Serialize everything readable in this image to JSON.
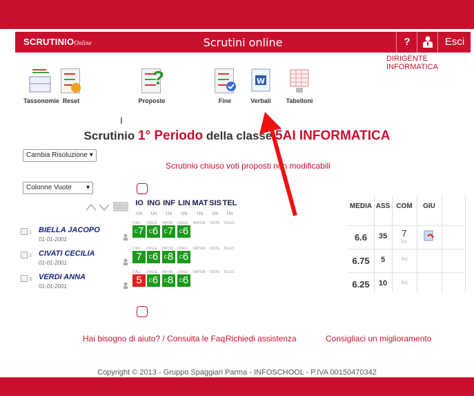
{
  "header": {
    "logo": "SCRUTINIO",
    "logo_sub": "Online",
    "title": "Scrutini online",
    "help_label": "?",
    "exit_label": "Esci",
    "role": "DIRIGENTE INFORMATICA"
  },
  "toolbar": [
    {
      "label": "Tassonomie",
      "icon": "tassonomie-icon"
    },
    {
      "label": "Reset",
      "icon": "reset-icon"
    },
    {
      "label": "Proposte",
      "icon": "proposte-icon"
    },
    {
      "label": "Fine",
      "icon": "fine-icon"
    },
    {
      "label": "Verbali",
      "icon": "verbali-icon"
    },
    {
      "label": "Tabelloni",
      "icon": "tabelloni-icon"
    }
  ],
  "scrutinio": {
    "prefix": "Scrutinio ",
    "period": "1° Periodo",
    "middle": " della classe ",
    "classe": "5AI INFORMATICA"
  },
  "risoluzione_select": "Cambia Risoluzione",
  "status_message": "Scrutinio chiuso voti proposti non modificabili",
  "colonne_select": "Colonne Vuote",
  "subjects": [
    {
      "code": "IO",
      "sub": "Un",
      "tag": "ITALI"
    },
    {
      "code": "ING",
      "sub": "Un",
      "tag": "INGLE"
    },
    {
      "code": "INF",
      "sub": "Un",
      "tag": "INFOR"
    },
    {
      "code": "LIN",
      "sub": "Un",
      "tag": "LINGU"
    },
    {
      "code": "MAT",
      "sub": "Un",
      "tag": "MATEM"
    },
    {
      "code": "SIS",
      "sub": "Un",
      "tag": "SISTE"
    },
    {
      "code": "TEL",
      "sub": "Un",
      "tag": "TELEC"
    }
  ],
  "stat_headers": {
    "media": "MEDIA",
    "ass": "ASS",
    "com": "COM",
    "giu": "GIU"
  },
  "students": [
    {
      "n": "1",
      "name": "BIELLA JACOPO",
      "dob": "01-01-2001",
      "grades": [
        {
          "v": "7",
          "sup": "C"
        },
        {
          "v": "6",
          "sup": "C"
        },
        {
          "v": "7",
          "sup": "C"
        },
        {
          "v": "6",
          "sup": "C"
        }
      ],
      "media": "6.6",
      "ass": "35",
      "com": "7",
      "com_sub": "P.C."
    },
    {
      "n": "2",
      "name": "CIVATI CECILIA",
      "dob": "01-01-2001",
      "grades": [
        {
          "v": "7",
          "sup": ""
        },
        {
          "v": "6",
          "sup": "C"
        },
        {
          "v": "8",
          "sup": "C"
        },
        {
          "v": "6",
          "sup": "C"
        }
      ],
      "media": "6.75",
      "ass": "5",
      "com": "",
      "com_sub": "P.C."
    },
    {
      "n": "3",
      "name": "VERDI ANNA",
      "dob": "01-01-2001",
      "grades": [
        {
          "v": "5",
          "sup": ""
        },
        {
          "v": "6",
          "sup": "C"
        },
        {
          "v": "8",
          "sup": "C"
        },
        {
          "v": "6",
          "sup": "C"
        }
      ],
      "media": "6.25",
      "ass": "10",
      "com": "",
      "com_sub": "P.C."
    }
  ],
  "footer": {
    "help": "Hai bisogno di aiuto? / Consulta le Faq",
    "assist": "Richiedi assistenza",
    "improve": "Consigliaci un miglioramento",
    "copyright": "Copyright © 2013 - Gruppo Spaggiari Parma - INFOSCHOOL - P.IVA 00150470342"
  },
  "colors": {
    "brand": "#c8102e",
    "pass": "#1a9a1a",
    "fail": "#e02020",
    "arrow": "#ee1111"
  }
}
